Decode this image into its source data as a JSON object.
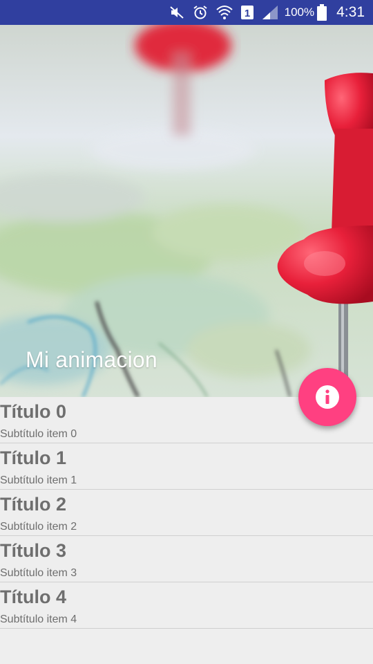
{
  "status_bar": {
    "battery_percent": "100%",
    "time": "4:31",
    "sim_slot": "1"
  },
  "header": {
    "title": "Mi animacion"
  },
  "fab": {
    "icon": "info-icon",
    "color": "#ff4081"
  },
  "list": {
    "items": [
      {
        "title": "Título 0",
        "subtitle": "Subtítulo item 0"
      },
      {
        "title": "Título 1",
        "subtitle": "Subtítulo item 1"
      },
      {
        "title": "Título 2",
        "subtitle": "Subtítulo item 2"
      },
      {
        "title": "Título 3",
        "subtitle": "Subtítulo item 3"
      },
      {
        "title": "Título 4",
        "subtitle": "Subtítulo item 4"
      }
    ]
  },
  "colors": {
    "status_bar": "#303f9f",
    "accent": "#ff4081",
    "list_background": "#eeeeee",
    "list_text": "#6e6e6e"
  }
}
